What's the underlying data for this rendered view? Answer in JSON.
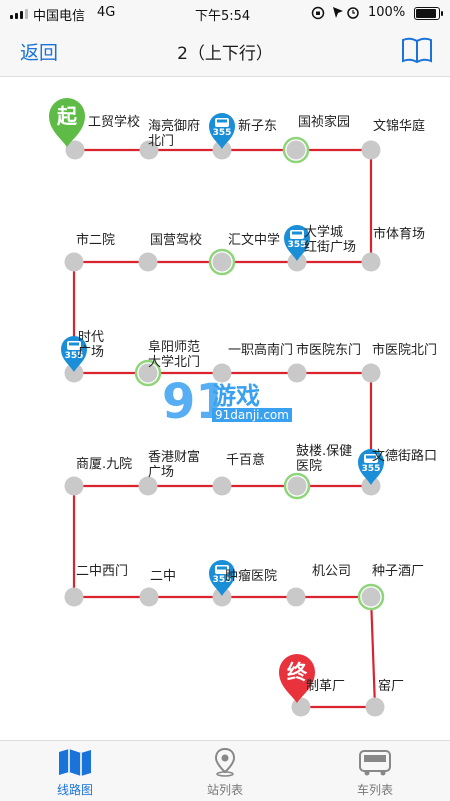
{
  "status": {
    "carrier": "中国电信",
    "network": "4G",
    "time": "下午5:54",
    "battery": "100%",
    "battery_level": 1.0
  },
  "nav": {
    "back_label": "返回",
    "title": "2（上下行）"
  },
  "route": {
    "start_badge": "起",
    "end_badge": "终",
    "line_color": "#d9232e",
    "bus_color": "#1a8fd8",
    "bus_number": "355",
    "stops": [
      "工贸学校",
      "海亮御府北门",
      "新子东",
      "国祯家园",
      "文锦华庭",
      "市体育场",
      "大学城红街广场",
      "汇文中学",
      "国营驾校",
      "市二院",
      "时代广场",
      "阜阳师范大学北门",
      "一职高南门",
      "市医院东门",
      "市医院北门",
      "文德街路口",
      "鼓楼.保健医院",
      "千百意",
      "香港财富广场",
      "商厦.九院",
      "二中西门",
      "二中",
      "肿瘤医院",
      "机公司",
      "种子酒厂",
      "窑厂",
      "制革厂"
    ]
  },
  "watermark": {
    "brand": "游戏",
    "site": "91danji.com"
  },
  "tabs": {
    "line_map": "线路图",
    "stop_list": "站列表",
    "bus_list": "车列表"
  }
}
